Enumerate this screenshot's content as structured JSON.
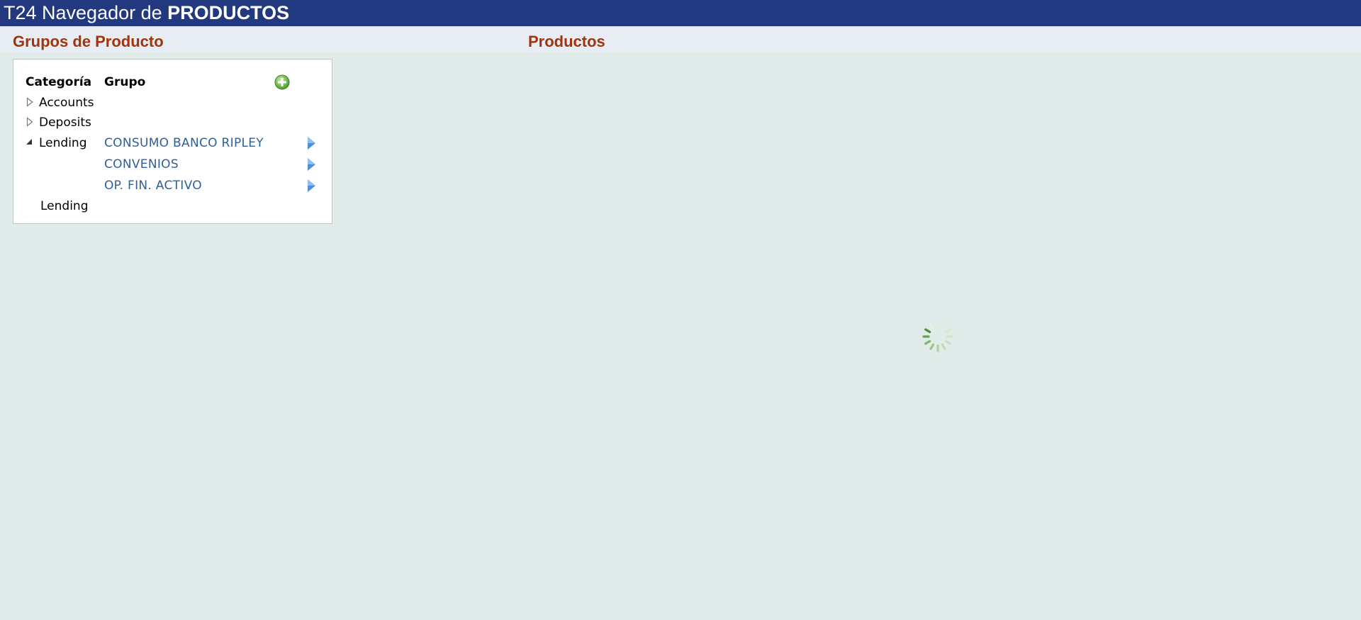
{
  "header": {
    "title_prefix": "T24 Navegador de ",
    "title_bold": "PRODUCTOS"
  },
  "left_section": {
    "title": "Grupos de Producto"
  },
  "right_section": {
    "title": "Productos"
  },
  "table": {
    "columns": [
      "Categoría",
      "Grupo"
    ],
    "add_icon": "add-icon",
    "categories": [
      {
        "label": "Accounts",
        "expanded": false
      },
      {
        "label": "Deposits",
        "expanded": false
      },
      {
        "label": "Lending",
        "expanded": true
      }
    ],
    "lending_groups": [
      "CONSUMO BANCO RIPLEY",
      "CONVENIOS",
      "OP. FIN. ACTIVO"
    ],
    "footer_label": "Lending"
  },
  "colors": {
    "title_bar": "#22397f",
    "section_title": "#a0340e",
    "group_link": "#2f5f9a",
    "background": "#e1ebe9"
  },
  "loading": {
    "icon": "loading-spinner-icon"
  }
}
